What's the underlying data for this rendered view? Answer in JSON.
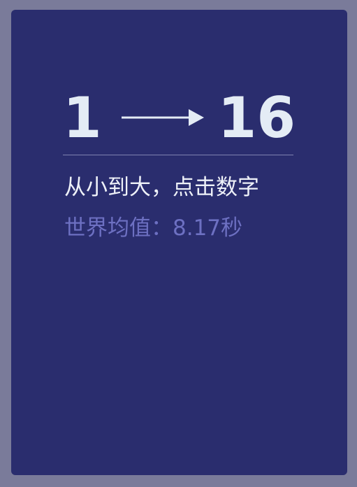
{
  "game": {
    "range_from": "1",
    "range_to": "16",
    "instruction": "从小到大，点击数字",
    "record_label": "世界均值：",
    "record_value": "8.17秒"
  },
  "colors": {
    "frame": "#7a7b9a",
    "card": "#2a2d6e",
    "title_text": "#e4ecf5",
    "divider": "#7f82b0",
    "instruction_text": "#eef1f8",
    "record_text": "#6d70c2"
  },
  "icons": {
    "arrow": "right-arrow-icon"
  }
}
